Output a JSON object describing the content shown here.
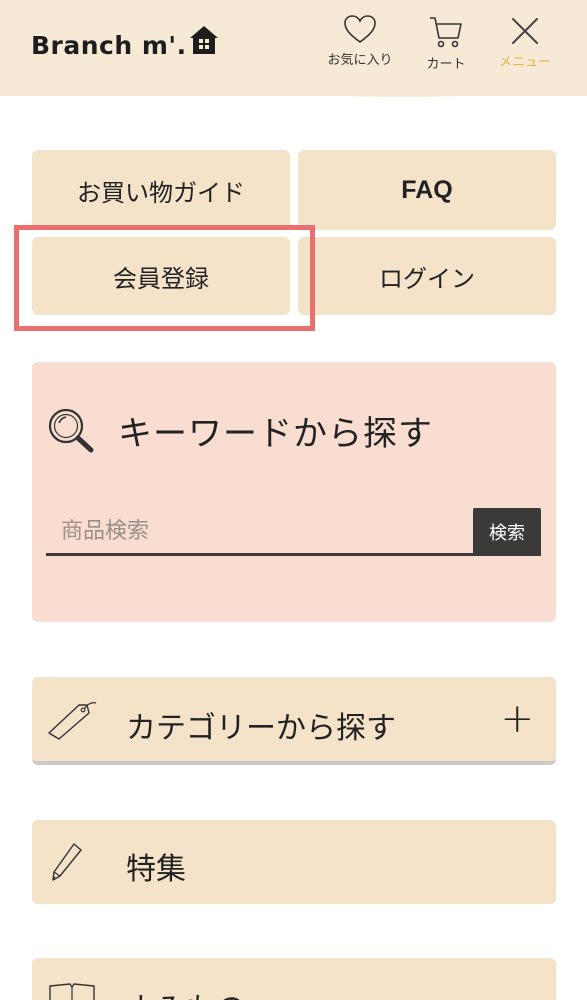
{
  "header": {
    "logo_text": "Branch m'.",
    "favorites_label": "お気に入り",
    "cart_label": "カート",
    "menu_label": "メニュー",
    "accent_color": "#e5b148",
    "background_color": "#f6ead7"
  },
  "menu_tiles": {
    "shopping_guide": "お買い物ガイド",
    "faq": "FAQ",
    "member_register": "会員登録",
    "login": "ログイン"
  },
  "search": {
    "title": "キーワードから探す",
    "placeholder": "商品検索",
    "button_label": "検索"
  },
  "sections": {
    "category": "カテゴリーから探す",
    "category_expand": "+",
    "feature": "特集",
    "reading": "よみもの"
  },
  "colors": {
    "tile_bg": "#f4e3c9",
    "search_bg": "#f9ddd1",
    "highlight_border": "#ec6f70"
  }
}
